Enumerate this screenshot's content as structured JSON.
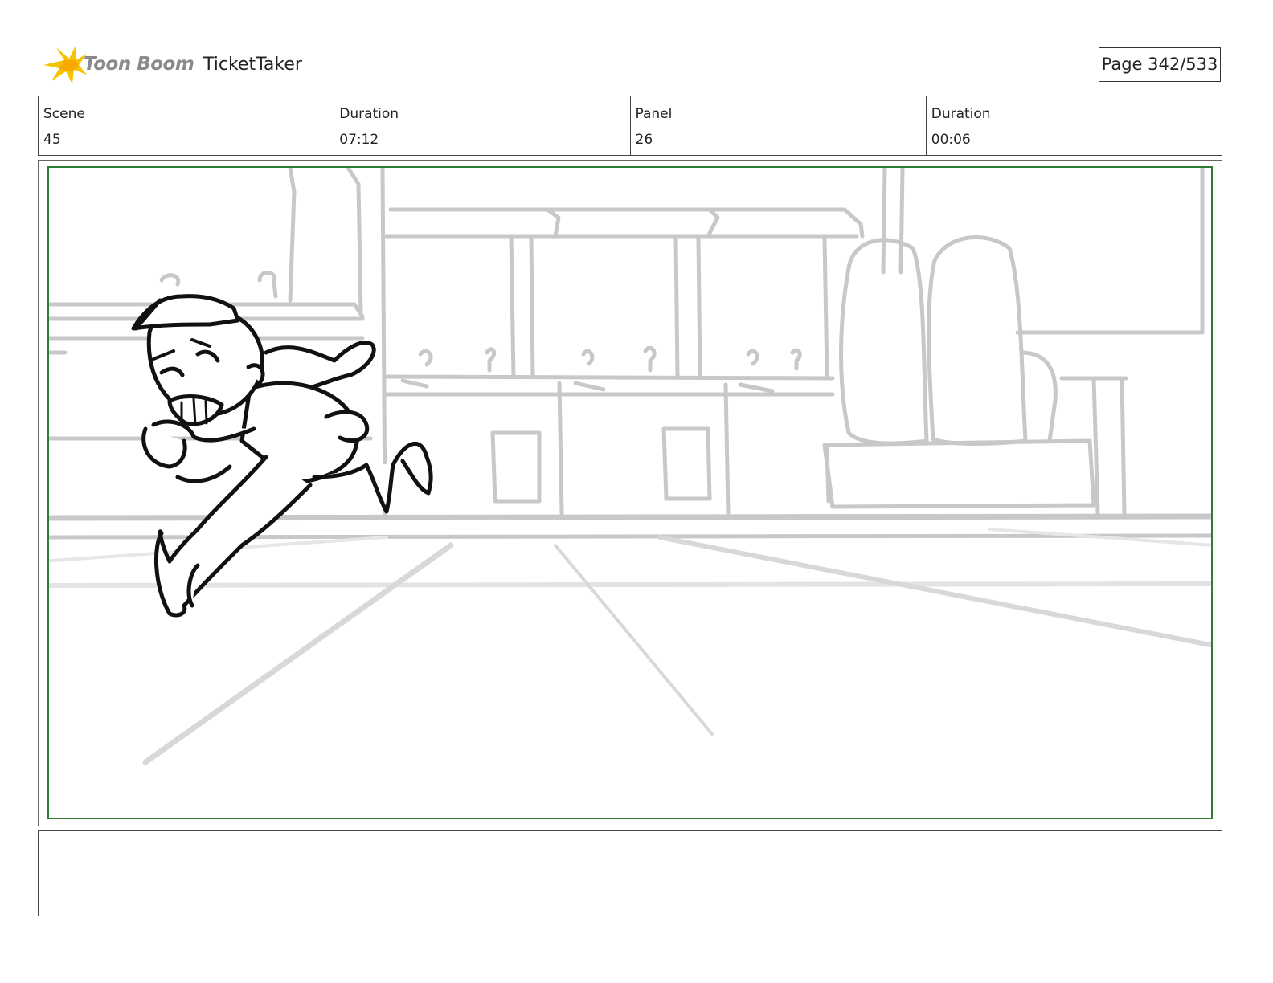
{
  "header": {
    "logo_text": "Toon Boom",
    "project_title": "TicketTaker",
    "page_label": "Page 342/533"
  },
  "info": {
    "scene_label": "Scene",
    "scene_value": "45",
    "scene_duration_label": "Duration",
    "scene_duration_value": "07:12",
    "panel_label": "Panel",
    "panel_value": "26",
    "panel_duration_label": "Duration",
    "panel_duration_value": "00:06"
  },
  "panel": {
    "description": ""
  },
  "notes": {
    "text": ""
  },
  "colors": {
    "logo_star": "#f5c400",
    "logo_text": "#8a8a8a",
    "panel_border": "#2e7d32",
    "background_sketch": "#c8c8c8",
    "character_ink": "#111111"
  }
}
